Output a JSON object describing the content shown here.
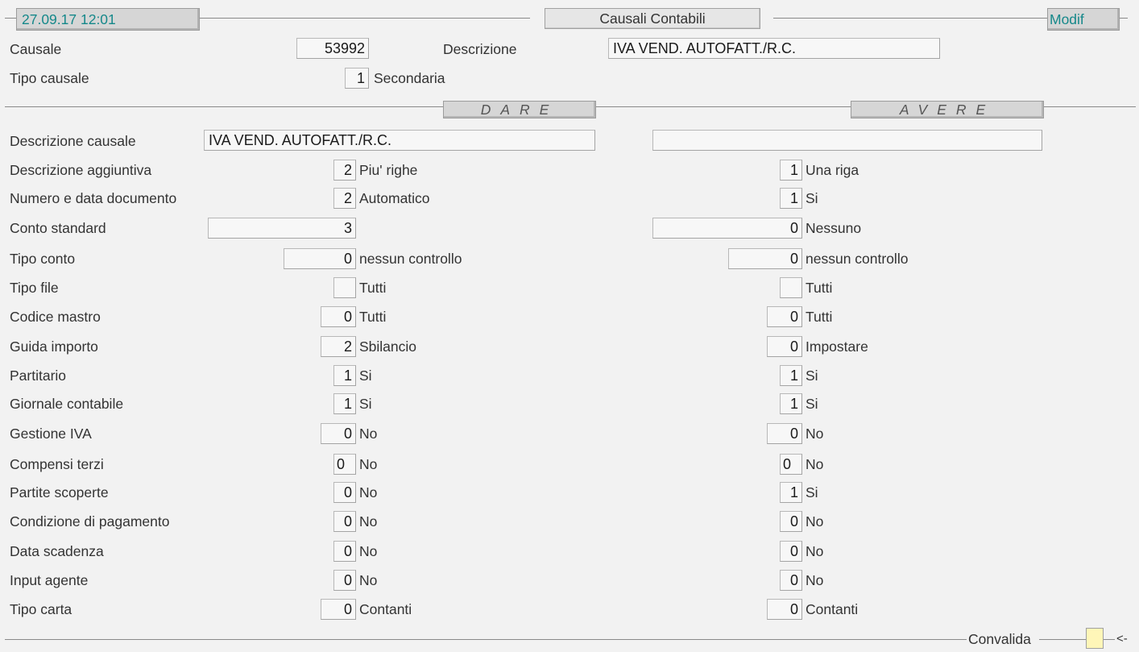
{
  "header": {
    "datetime": "27.09.17 12:01",
    "title": "Causali Contabili",
    "mode": "Modif"
  },
  "top": {
    "causale_label": "Causale",
    "causale_value": "53992",
    "descrizione_label": "Descrizione",
    "descrizione_value": "IVA VEND. AUTOFATT./R.C.",
    "tipo_label": "Tipo causale",
    "tipo_value": "1",
    "tipo_text": "Secondaria"
  },
  "sections": {
    "dare": "DARE",
    "avere": "AVERE"
  },
  "descrizione_causale": {
    "label": "Descrizione causale",
    "dare": "IVA VEND. AUTOFATT./R.C.",
    "avere": ""
  },
  "rows": [
    {
      "label": "Descrizione aggiuntiva",
      "dare_val": "2",
      "dare_txt": "Piu' righe",
      "avere_val": "1",
      "avere_txt": "Una riga"
    },
    {
      "label": "Numero e data documento",
      "dare_val": "2",
      "dare_txt": "Automatico",
      "avere_val": "1",
      "avere_txt": "Si"
    },
    {
      "label": "Conto standard",
      "dare_val": "3",
      "dare_txt": "",
      "avere_val": "0",
      "avere_txt": "Nessuno"
    },
    {
      "label": "Tipo conto",
      "dare_val": "0",
      "dare_txt": "nessun controllo",
      "avere_val": "0",
      "avere_txt": "nessun controllo"
    },
    {
      "label": "Tipo file",
      "dare_val": "",
      "dare_txt": "Tutti",
      "avere_val": "",
      "avere_txt": "Tutti"
    },
    {
      "label": "Codice mastro",
      "dare_val": "0",
      "dare_txt": "Tutti",
      "avere_val": "0",
      "avere_txt": "Tutti"
    },
    {
      "label": "Guida importo",
      "dare_val": "2",
      "dare_txt": "Sbilancio",
      "avere_val": "0",
      "avere_txt": "Impostare"
    },
    {
      "label": "Partitario",
      "dare_val": "1",
      "dare_txt": "Si",
      "avere_val": "1",
      "avere_txt": "Si"
    },
    {
      "label": "Giornale contabile",
      "dare_val": "1",
      "dare_txt": "Si",
      "avere_val": "1",
      "avere_txt": "Si"
    },
    {
      "label": "Gestione IVA",
      "dare_val": "0",
      "dare_txt": "No",
      "avere_val": "0",
      "avere_txt": "No"
    },
    {
      "label": "Compensi terzi",
      "dare_val": "0",
      "dare_txt": "No",
      "avere_val": "0",
      "avere_txt": "No"
    },
    {
      "label": "Partite scoperte",
      "dare_val": "0",
      "dare_txt": "No",
      "avere_val": "1",
      "avere_txt": "Si"
    },
    {
      "label": "Condizione di pagamento",
      "dare_val": "0",
      "dare_txt": "No",
      "avere_val": "0",
      "avere_txt": "No"
    },
    {
      "label": "Data scadenza",
      "dare_val": "0",
      "dare_txt": "No",
      "avere_val": "0",
      "avere_txt": "No"
    },
    {
      "label": "Input agente",
      "dare_val": "0",
      "dare_txt": "No",
      "avere_val": "0",
      "avere_txt": "No"
    },
    {
      "label": "Tipo carta",
      "dare_val": "0",
      "dare_txt": "Contanti",
      "avere_val": "0",
      "avere_txt": "Contanti"
    }
  ],
  "footer": {
    "convalida_label": "Convalida",
    "arrow": "<-"
  },
  "colors": {
    "background": "#f2f2f2",
    "accent_teal": "#15888a",
    "validate_box": "#fff6b8"
  }
}
